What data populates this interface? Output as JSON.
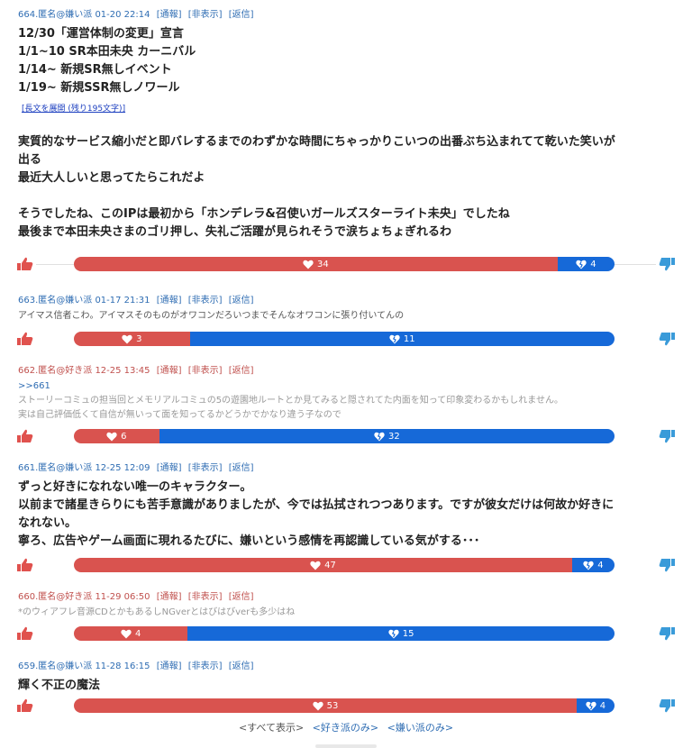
{
  "comments": [
    {
      "header": "664.匿名@嫌い派 01-20 22:14",
      "actions": [
        "[通報]",
        "[非表示]",
        "[返信]"
      ],
      "lines": [
        "12/30「運営体制の変更」宣言",
        "1/1~10 SR本田未央 カーニバル",
        "1/14~ 新規SR無しイベント",
        "1/19~ 新規SSR無しノワール"
      ],
      "expand": "[長文を展開 (残り195文字)]",
      "lines2": [
        "実質的なサービス縮小だと即バレするまでのわずかな時間にちゃっかりこいつの出番ぶち込まれてて乾いた笑いが",
        "出る",
        "最近大人しいと思ってたらこれだよ"
      ],
      "lines3": [
        "そうでしたね、このIPは最初から「ホンデレラ&召使いガールズスターライト未央」でしたね",
        "最後まで本田未央さまのゴリ押し、失礼ご活躍が見られそうで涙ちょちょぎれるわ"
      ],
      "likes": 34,
      "dislikes": 4
    },
    {
      "header": "663.匿名@嫌い派 01-17 21:31",
      "actions": [
        "[通報]",
        "[非表示]",
        "[返信]"
      ],
      "lines": [
        "アイマス信者こわ。アイマスそのものがオワコンだろいつまでそんなオワコンに張り付いてんの"
      ],
      "likes": 3,
      "dislikes": 11
    },
    {
      "header": "662.匿名@好き派 12-25 13:45",
      "actions": [
        "[通報]",
        "[非表示]",
        "[返信]"
      ],
      "reply": ">>661",
      "lines": [
        "ストーリーコミュの担当回とメモリアルコミュの5の遊園地ルートとか見てみると隠されてた内面を知って印象変わるかもしれません。",
        "実は自己評価低くて自信が無いって面を知ってるかどうかでかなり違う子なので"
      ],
      "likes": 6,
      "dislikes": 32
    },
    {
      "header": "661.匿名@嫌い派 12-25 12:09",
      "actions": [
        "[通報]",
        "[非表示]",
        "[返信]"
      ],
      "lines": [
        "ずっと好きになれない唯一のキャラクター。",
        "以前まで諸星きらりにも苦手意識がありましたが、今では払拭されつつあります。ですが彼女だけは何故か好きに",
        "なれない。",
        "寧ろ、広告やゲーム画面に現れるたびに、嫌いという感情を再認識している気がする･･･"
      ],
      "likes": 47,
      "dislikes": 4
    },
    {
      "header": "660.匿名@好き派 11-29 06:50",
      "actions": [
        "[通報]",
        "[非表示]",
        "[返信]"
      ],
      "lines": [
        "*のウィアフレ音源CDとかもあるしNGverとはびはびverも多少はね"
      ],
      "likes": 4,
      "dislikes": 15
    },
    {
      "header": "659.匿名@嫌い派 11-28 16:15",
      "actions": [
        "[通報]",
        "[非表示]",
        "[返信]"
      ],
      "lines": [
        "輝く不正の魔法"
      ],
      "likes": 53,
      "dislikes": 4
    }
  ],
  "footer": {
    "all": "<すべて表示>",
    "fav": "<好き派のみ>",
    "hate": "<嫌い派のみ>"
  },
  "colors": {
    "like": "#d9534f",
    "dislike": "#1669d8",
    "thumb_up": "#e0524e",
    "thumb_down": "#3a9bd9"
  }
}
